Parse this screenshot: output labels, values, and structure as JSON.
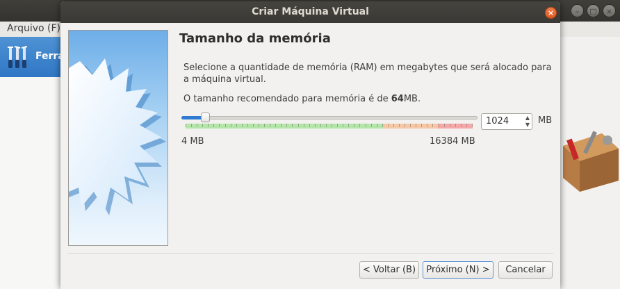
{
  "background_window": {
    "menu_file": "Arquivo (F)",
    "tools_label": "Ferra"
  },
  "dialog": {
    "title": "Criar Máquina Virtual",
    "close_icon": "close-icon",
    "page_title": "Tamanho da memória",
    "description": "Selecione a quantidade de memória (RAM) em megabytes que será alocado para a máquina virtual.",
    "recommended_prefix": "O tamanho recomendado para memória é de ",
    "recommended_value": "64",
    "recommended_suffix": "MB.",
    "memory": {
      "value": "1024",
      "unit": "MB",
      "min_label": "4 MB",
      "max_label": "16384 MB",
      "min_mb": 4,
      "max_mb": 16384,
      "current_mb": 1024
    },
    "buttons": {
      "back": "< Voltar (B)",
      "next": "Próximo (N) >",
      "cancel": "Cancelar"
    }
  },
  "colors": {
    "accent": "#2f7bd1",
    "zone_green": "#b5e6a9",
    "zone_orange": "#f6c8a6",
    "zone_red": "#f6a8a8",
    "close_button": "#e15a22"
  }
}
